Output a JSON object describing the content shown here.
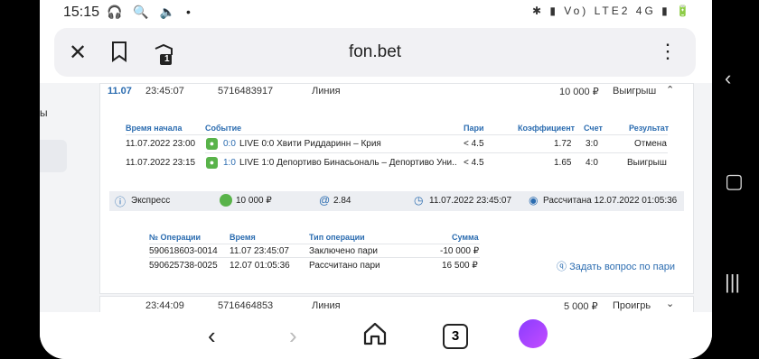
{
  "status_bar": {
    "time": "15:15",
    "left_icons": "🎧 🔍 🔈 •",
    "right_icons": "✱ ▮ Vo) LTE2 4G ▮ 🔋"
  },
  "browser": {
    "url": "fon.bet",
    "tab_badge": "1",
    "tabs_count": "3"
  },
  "sidebar": {
    "partial_text": "ы"
  },
  "bet": {
    "date": "11.07",
    "time": "23:45:07",
    "id": "5716483917",
    "type": "Линия",
    "amount": "10 000 ₽",
    "result": "Выигрыш",
    "events_header": {
      "start": "Время начала",
      "event": "Событие",
      "bet": "Пари",
      "coef": "Коэффициент",
      "score": "Счет",
      "result": "Результат"
    },
    "events": [
      {
        "start": "11.07.2022 23:00",
        "score_live": "0:0",
        "name": "LIVE 0:0 Хвити Риддаринн – Крия",
        "bet": "< 4.5",
        "coef": "1.72",
        "score": "3:0",
        "result": "Отмена"
      },
      {
        "start": "11.07.2022 23:15",
        "score_live": "1:0",
        "name": "LIVE 1:0 Депортиво Бинасьональ – Депортиво Уни...",
        "bet": "< 4.5",
        "coef": "1.65",
        "score": "4:0",
        "result": "Выигрыш"
      }
    ],
    "summary": {
      "kind": "Экспресс",
      "stake": "10 000 ₽",
      "coef": "2.84",
      "placed": "11.07.2022 23:45:07",
      "settled": "Рассчитана 12.07.2022 01:05:36"
    },
    "ops_header": {
      "num": "№ Операции",
      "time": "Время",
      "type": "Тип операции",
      "sum": "Сумма"
    },
    "ops": [
      {
        "num": "590618603-0014",
        "time": "11.07 23:45:07",
        "type": "Заключено пари",
        "sum": "-10 000 ₽"
      },
      {
        "num": "590625738-0025",
        "time": "12.07 01:05:36",
        "type": "Рассчитано пари",
        "sum": "16 500 ₽"
      }
    ],
    "ask_link": "Задать вопрос по пари"
  },
  "bet2": {
    "time": "23:44:09",
    "id": "5716464853",
    "type": "Линия",
    "amount": "5 000 ₽",
    "result": "Проигрь"
  }
}
